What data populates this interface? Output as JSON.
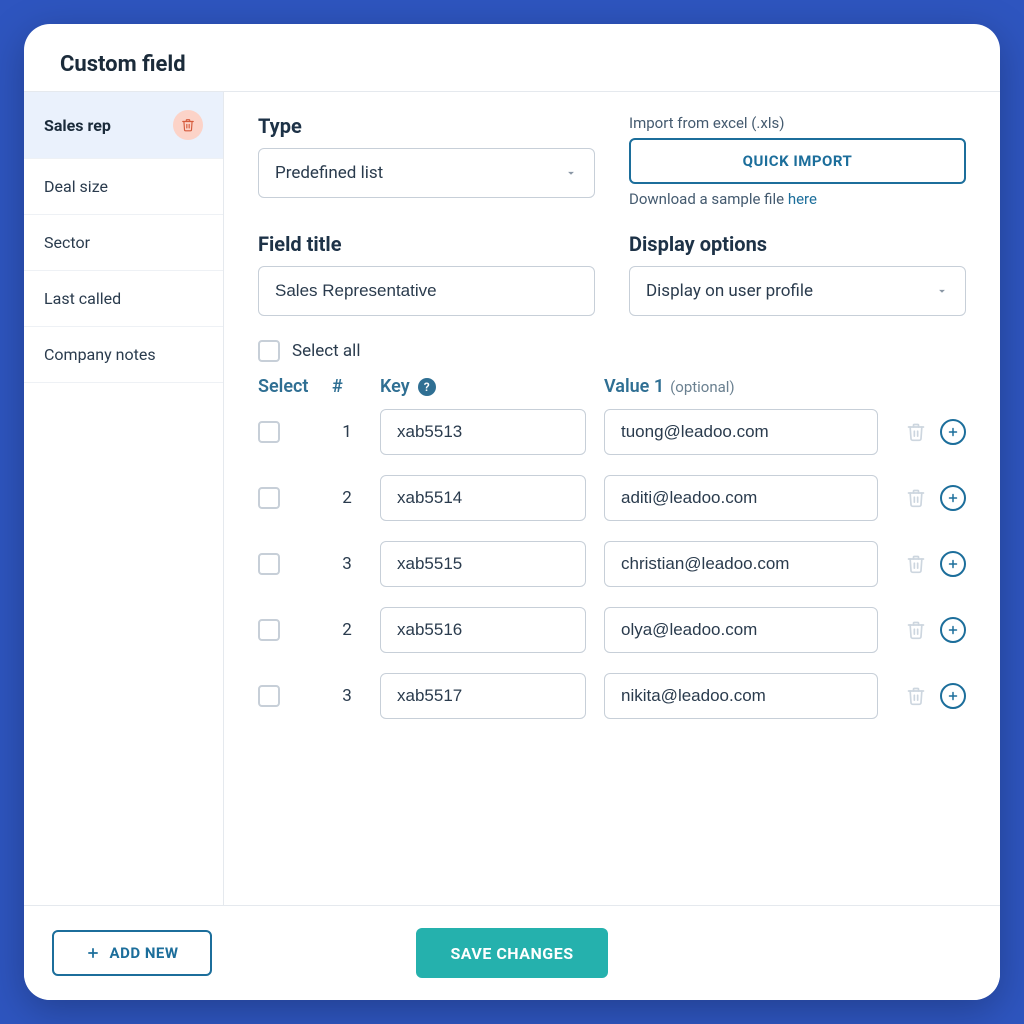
{
  "header": {
    "title": "Custom field"
  },
  "sidebar": {
    "items": [
      {
        "label": "Sales rep",
        "active": true,
        "deletable": true
      },
      {
        "label": "Deal size",
        "active": false
      },
      {
        "label": "Sector",
        "active": false
      },
      {
        "label": "Last called",
        "active": false
      },
      {
        "label": "Company notes",
        "active": false
      }
    ]
  },
  "form": {
    "type_label": "Type",
    "type_value": "Predefined list",
    "import_label": "Import from excel (.xls)",
    "quick_import_label": "QUICK IMPORT",
    "sample_text": "Download a sample file ",
    "sample_link": "here",
    "field_title_label": "Field title",
    "field_title_value": "Sales Representative",
    "display_label": "Display options",
    "display_value": "Display on user profile"
  },
  "table": {
    "select_all_label": "Select all",
    "head_select": "Select",
    "head_num": "#",
    "head_key": "Key",
    "head_value": "Value 1",
    "head_value_note": "(optional)",
    "rows": [
      {
        "num": "1",
        "key": "xab5513",
        "value": "tuong@leadoo.com"
      },
      {
        "num": "2",
        "key": "xab5514",
        "value": "aditi@leadoo.com"
      },
      {
        "num": "3",
        "key": "xab5515",
        "value": "christian@leadoo.com"
      },
      {
        "num": "2",
        "key": "xab5516",
        "value": "olya@leadoo.com"
      },
      {
        "num": "3",
        "key": "xab5517",
        "value": "nikita@leadoo.com"
      }
    ]
  },
  "footer": {
    "add_new_label": "ADD NEW",
    "save_label": "SAVE CHANGES"
  }
}
